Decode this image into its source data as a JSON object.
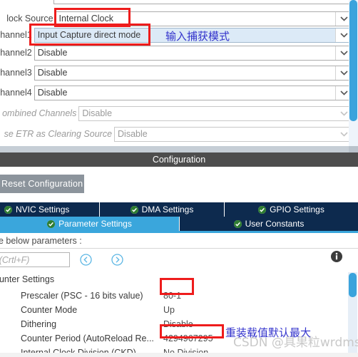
{
  "app": {
    "config_header": "Configuration",
    "reset_button": "Reset Configuration"
  },
  "top_panel": {
    "rows": [
      {
        "label": "lock Source",
        "value": "Internal Clock",
        "disabled": false,
        "highlight": false
      },
      {
        "label": "hannel1",
        "value": "Input Capture direct mode",
        "disabled": false,
        "highlight": true
      },
      {
        "label": "hannel2",
        "value": "Disable",
        "disabled": false,
        "highlight": false
      },
      {
        "label": "hannel3",
        "value": "Disable",
        "disabled": false,
        "highlight": false
      },
      {
        "label": "hannel4",
        "value": "Disable",
        "disabled": false,
        "highlight": false
      },
      {
        "label": "ombined Channels",
        "value": "Disable",
        "disabled": true,
        "highlight": false
      },
      {
        "label": "se ETR as Clearing Source",
        "value": "Disable",
        "disabled": true,
        "highlight": false
      }
    ],
    "annotation_zh": "输入捕获模式"
  },
  "tabs": {
    "row1": [
      {
        "label": "NVIC Settings",
        "active": false
      },
      {
        "label": "DMA Settings",
        "active": false
      },
      {
        "label": "GPIO Settings",
        "active": false
      }
    ],
    "row2": [
      {
        "label": "Parameter Settings",
        "active": true
      },
      {
        "label": "User Constants",
        "active": false
      }
    ]
  },
  "params": {
    "configure_line": "ure the below parameters :",
    "search_placeholder": "earch (Crtl+F)",
    "group_title": "ounter Settings",
    "rows": [
      {
        "name": "Prescaler (PSC - 16 bits value)",
        "value": "80-1"
      },
      {
        "name": "Counter Mode",
        "value": "Up"
      },
      {
        "name": "Dithering",
        "value": "Disable"
      },
      {
        "name": "Counter Period (AutoReload Re...",
        "value": "4294967295"
      },
      {
        "name": "Internal Clock Division (CKD)",
        "value": "No Division"
      }
    ],
    "annotation_zh": "重装载值默认最大"
  },
  "watermark": "CSDN @具果粒wrdms",
  "colors": {
    "accent_blue": "#3aa6dc",
    "tab_dark": "#0d2a4e",
    "annotation_red": "#ee1c1c",
    "annotation_blue": "#3333cc",
    "header_gray": "#4d4d4d",
    "highlight_row": "#dceaf7"
  }
}
